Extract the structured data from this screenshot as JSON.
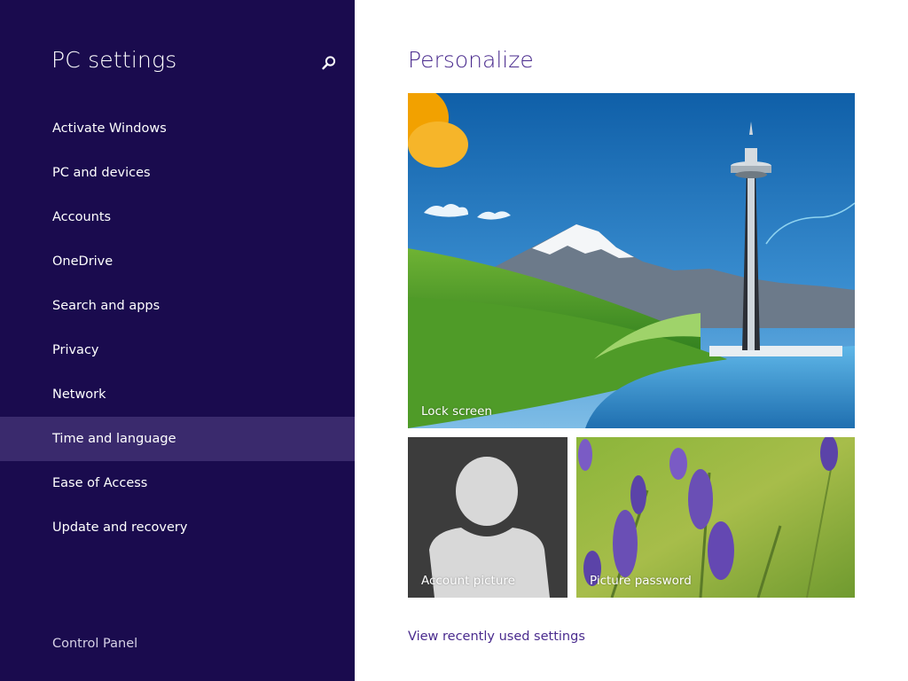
{
  "colors": {
    "sidebar_bg": "#1a0b4e",
    "selected_bg": "#3a2a6d",
    "accent": "#4a2b8e"
  },
  "sidebar": {
    "title": "PC settings",
    "search_icon": "search-icon",
    "items": [
      {
        "label": "Activate Windows",
        "selected": false
      },
      {
        "label": "PC and devices",
        "selected": false
      },
      {
        "label": "Accounts",
        "selected": false
      },
      {
        "label": "OneDrive",
        "selected": false
      },
      {
        "label": "Search and apps",
        "selected": false
      },
      {
        "label": "Privacy",
        "selected": false
      },
      {
        "label": "Network",
        "selected": false
      },
      {
        "label": "Time and language",
        "selected": true
      },
      {
        "label": "Ease of Access",
        "selected": false
      },
      {
        "label": "Update and recovery",
        "selected": false
      }
    ],
    "footer_link": "Control Panel"
  },
  "main": {
    "title": "Personalize",
    "tiles": {
      "lock_screen": "Lock screen",
      "account_picture": "Account picture",
      "picture_password": "Picture password"
    },
    "recent_link": "View recently used settings"
  }
}
